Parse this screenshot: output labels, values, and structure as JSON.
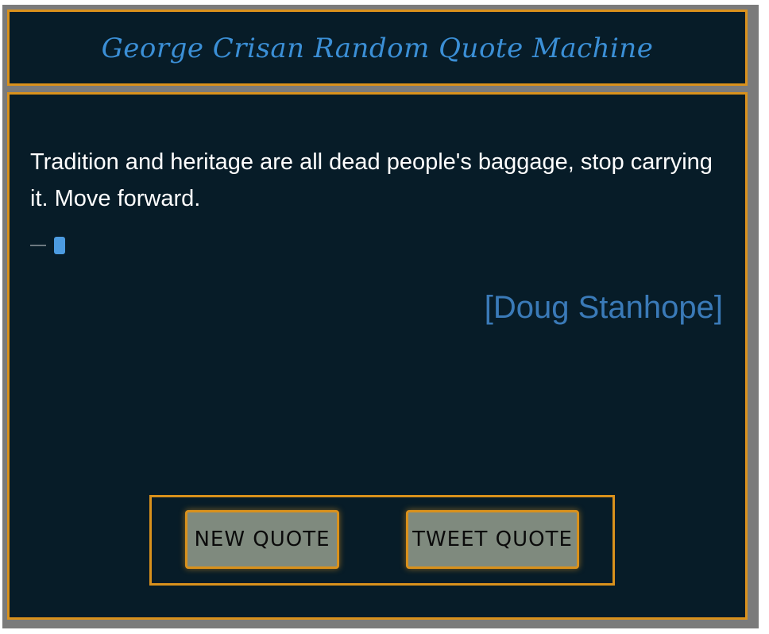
{
  "header": {
    "title": "George Crisan Random Quote Machine"
  },
  "quote": {
    "text": "Tradition and heritage are all dead people's baggage, stop carrying it. Move forward.",
    "dash": "—",
    "author": "[Doug Stanhope]"
  },
  "buttons": {
    "new_quote_label": "NEW QUOTE",
    "tweet_quote_label": "TWEET QUOTE"
  },
  "colors": {
    "background": "#071c28",
    "border_accent": "#d9911c",
    "title": "#3b8fd6",
    "author": "#3a7ab8",
    "button_bg": "#7f8a7e"
  }
}
